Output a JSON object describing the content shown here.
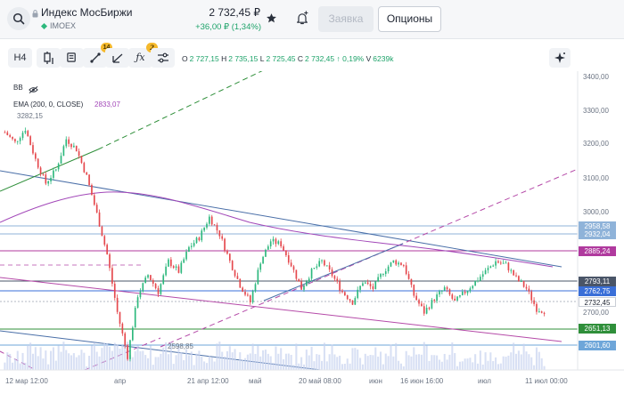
{
  "header": {
    "ticker_name": "Индекс МосБиржи",
    "ticker_code": "IMOEX",
    "price": "2 732,45 ₽",
    "change": "+36,00 ₽ (1,34%)",
    "order_label": "Заявка",
    "options_label": "Опционы"
  },
  "toolbar": {
    "timeframe": "H4",
    "drawings_badge": "14",
    "indicators_badge": "2",
    "ohlc": {
      "o_label": "O",
      "o": "2 727,15",
      "h_label": "H",
      "h": "2 735,15",
      "l_label": "L",
      "l": "2 725,45",
      "c_label": "C",
      "c": "2 732,45",
      "chg": "↑ 0,19%",
      "v_label": "V",
      "v": "6239k"
    }
  },
  "indicators": {
    "bb_label": "BB",
    "ema_label": "EMA",
    "ema_params": "(200, 0, CLOSE)",
    "ema_value": "2833,07"
  },
  "chart_data": {
    "type": "line",
    "y_ticks": [
      "3400,00",
      "3300,00",
      "3200,00",
      "3100,00",
      "3000,00",
      "2700,00"
    ],
    "x_ticks": [
      "12 мар 12:00",
      "апр",
      "21 апр 12:00",
      "май",
      "20 май 08:00",
      "июн",
      "16 июн 16:00",
      "июл",
      "11 июл 00:00"
    ],
    "high_label": "3282,15",
    "low_label": "2598,85",
    "ylim": [
      2560,
      3440
    ],
    "level_tags": [
      {
        "value": "2958,58",
        "color": "#8fb3d9"
      },
      {
        "value": "2932,04",
        "color": "#8fb3d9"
      },
      {
        "value": "2885,24",
        "color": "#b03a9e"
      },
      {
        "value": "2793,11",
        "color": "#4a5568"
      },
      {
        "value": "2762,75",
        "color": "#3a6fd8"
      },
      {
        "value": "2732,45",
        "color": "#ffffff"
      },
      {
        "value": "2651,13",
        "color": "#2f8f3a"
      },
      {
        "value": "2601,60",
        "color": "#6ea6d9"
      }
    ],
    "close_series": [
      3260,
      3230,
      3270,
      3180,
      3110,
      3150,
      3240,
      3210,
      3130,
      3020,
      2900,
      2730,
      2600,
      2780,
      2840,
      2790,
      2880,
      2850,
      2920,
      2950,
      3010,
      2960,
      2880,
      2810,
      2760,
      2880,
      2940,
      2930,
      2870,
      2800,
      2850,
      2880,
      2840,
      2790,
      2760,
      2820,
      2800,
      2850,
      2880,
      2870,
      2780,
      2730,
      2770,
      2800,
      2760,
      2790,
      2820,
      2850,
      2880,
      2870,
      2830,
      2800,
      2740,
      2732
    ]
  }
}
